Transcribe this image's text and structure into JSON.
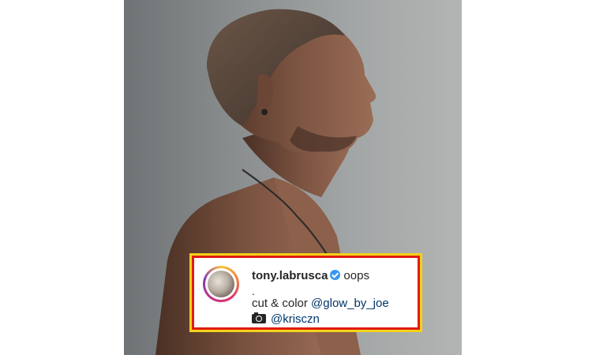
{
  "post": {
    "username": "tony.labrusca",
    "verified": true,
    "caption_text": "oops",
    "dot": ".",
    "credit_line_text": "cut & color",
    "credit_mention": "@glow_by_joe",
    "photo_icon": "camera-icon",
    "photo_mention": "@krisczn"
  },
  "colors": {
    "highlight_border": "#e01b10",
    "highlight_outline": "#f4d21a",
    "mention": "#003569",
    "verified_badge": "#3897f0"
  }
}
